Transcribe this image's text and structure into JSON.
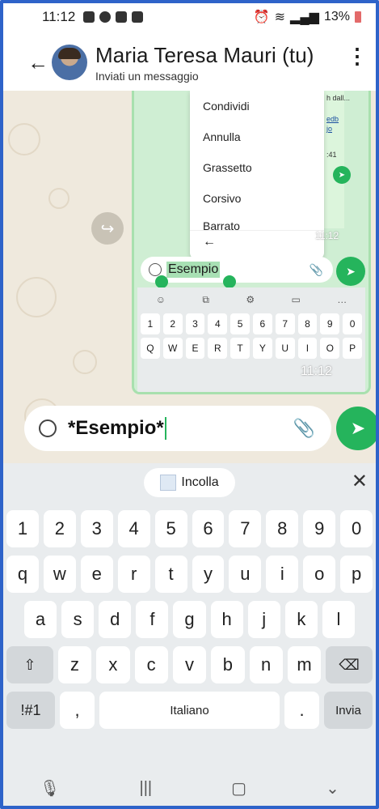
{
  "status": {
    "time": "11:12",
    "battery": "13%"
  },
  "header": {
    "title": "Maria Teresa Mauri (tu)",
    "subtitle": "Inviati un messaggio"
  },
  "inner_screenshot": {
    "menu_items": [
      "Condividi",
      "Annulla",
      "Grassetto",
      "Corsivo",
      "Barrato"
    ],
    "snippet_1": "h dall...",
    "snippet_2": "edb",
    "snippet_3": "jo",
    "snippet_4": ":41",
    "input_text": "Esempio",
    "time_small": "11:12",
    "time": "11:12",
    "num_row": [
      "1",
      "2",
      "3",
      "4",
      "5",
      "6",
      "7",
      "8",
      "9",
      "0"
    ],
    "letter_row": [
      "Q",
      "W",
      "E",
      "R",
      "T",
      "Y",
      "U",
      "I",
      "O",
      "P"
    ]
  },
  "composer": {
    "text": "*Esempio*"
  },
  "keyboard": {
    "paste_label": "Incolla",
    "row_numbers": [
      "1",
      "2",
      "3",
      "4",
      "5",
      "6",
      "7",
      "8",
      "9",
      "0"
    ],
    "row_1": [
      "q",
      "w",
      "e",
      "r",
      "t",
      "y",
      "u",
      "i",
      "o",
      "p"
    ],
    "row_2": [
      "a",
      "s",
      "d",
      "f",
      "g",
      "h",
      "j",
      "k",
      "l"
    ],
    "row_3": [
      "z",
      "x",
      "c",
      "v",
      "b",
      "n",
      "m"
    ],
    "symbols_label": "!#1",
    "comma_label": ",",
    "space_label": "Italiano",
    "period_label": ".",
    "enter_label": "Invia"
  },
  "colors": {
    "accent": "#25b45c",
    "chat_bg": "#efe9dd",
    "keyboard_bg": "#e9ecee"
  }
}
